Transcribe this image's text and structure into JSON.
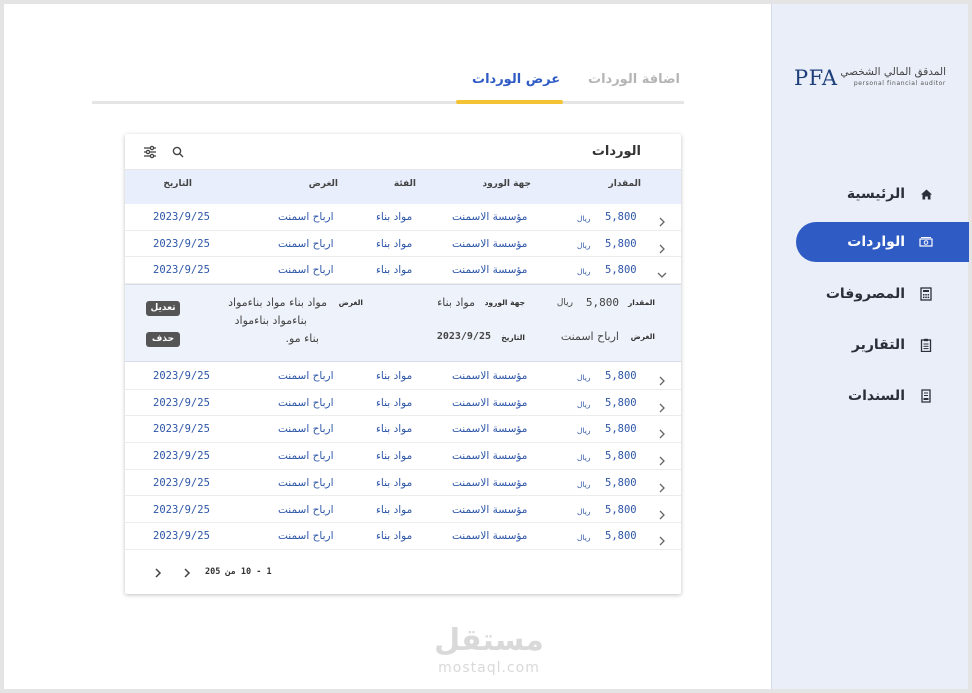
{
  "logo": {
    "brand": "PFA",
    "title_ar": "المدقق المالي الشخصي",
    "subtitle_en": "personal financial auditor"
  },
  "nav": [
    {
      "label": "الرئيسية",
      "icon": "home-icon",
      "active": false
    },
    {
      "label": "الواردات",
      "icon": "money-icon",
      "active": true
    },
    {
      "label": "المصروفات",
      "icon": "calculator-icon",
      "active": false
    },
    {
      "label": "التقارير",
      "icon": "clipboard-icon",
      "active": false
    },
    {
      "label": "السندات",
      "icon": "receipt-icon",
      "active": false
    }
  ],
  "tabs": {
    "view": "عرض الوردات",
    "add": "اضافة الوردات"
  },
  "card": {
    "title": "الوردات",
    "columns": {
      "amount": "المقدار",
      "source": "جهة الورود",
      "category": "الفئة",
      "purpose": "الغرض",
      "date": "التاريخ"
    }
  },
  "rows": [
    {
      "amount": "5,800",
      "currency": "ريال",
      "source": "مؤسسة الاسمنت",
      "category": "مواد بناء",
      "purpose": "ارباح اسمنت",
      "date": "2023/9/25"
    },
    {
      "amount": "5,800",
      "currency": "ريال",
      "source": "مؤسسة الاسمنت",
      "category": "مواد بناء",
      "purpose": "ارباح اسمنت",
      "date": "2023/9/25"
    },
    {
      "amount": "5,800",
      "currency": "ريال",
      "source": "مؤسسة الاسمنت",
      "category": "مواد بناء",
      "purpose": "ارباح اسمنت",
      "date": "2023/9/25"
    },
    {
      "amount": "5,800",
      "currency": "ريال",
      "source": "مؤسسة الاسمنت",
      "category": "مواد بناء",
      "purpose": "ارباح اسمنت",
      "date": "2023/9/25"
    },
    {
      "amount": "5,800",
      "currency": "ريال",
      "source": "مؤسسة الاسمنت",
      "category": "مواد بناء",
      "purpose": "ارباح اسمنت",
      "date": "2023/9/25"
    },
    {
      "amount": "5,800",
      "currency": "ريال",
      "source": "مؤسسة الاسمنت",
      "category": "مواد بناء",
      "purpose": "ارباح اسمنت",
      "date": "2023/9/25"
    },
    {
      "amount": "5,800",
      "currency": "ريال",
      "source": "مؤسسة الاسمنت",
      "category": "مواد بناء",
      "purpose": "ارباح اسمنت",
      "date": "2023/9/25"
    },
    {
      "amount": "5,800",
      "currency": "ريال",
      "source": "مؤسسة الاسمنت",
      "category": "مواد بناء",
      "purpose": "ارباح اسمنت",
      "date": "2023/9/25"
    },
    {
      "amount": "5,800",
      "currency": "ريال",
      "source": "مؤسسة الاسمنت",
      "category": "مواد بناء",
      "purpose": "ارباح اسمنت",
      "date": "2023/9/25"
    },
    {
      "amount": "5,800",
      "currency": "ريال",
      "source": "مؤسسة الاسمنت",
      "category": "مواد بناء",
      "purpose": "ارباح اسمنت",
      "date": "2023/9/25"
    }
  ],
  "detail": {
    "amount_label": "المقدار",
    "amount": "5,800",
    "currency": "ريال",
    "source_label": "جهة الورود",
    "source": "مواد بناء",
    "purpose_label": "الغرض",
    "purpose_line1": "مواد بناء مواد بناءمواد",
    "purpose_line2": "بناءمواد بناءمواد",
    "purpose_line3": "بناء مو.",
    "purpose2_label": "الغرض",
    "purpose2": "ارباح اسمنت",
    "date_label": "التاريخ",
    "date": "2023/9/25",
    "edit_label": "تعديل",
    "delete_label": "حذف"
  },
  "pager": {
    "text": "1 - 10 من 205"
  },
  "watermark": {
    "ar": "مستقل",
    "en": "mostaql.com"
  },
  "colors": {
    "accent": "#2f5bc4",
    "tab_underline": "#f4c334",
    "sidebar_bg": "#e9eef8",
    "table_header_bg": "#e8eefb"
  }
}
